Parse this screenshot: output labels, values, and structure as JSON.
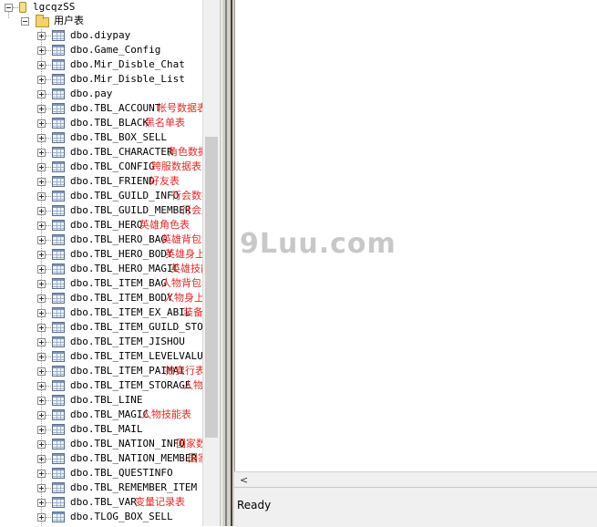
{
  "tree": {
    "database": "lgcqzSS",
    "folder": "用户表",
    "tables": [
      {
        "name": "dbo.diypay",
        "note": ""
      },
      {
        "name": "dbo.Game_Config",
        "note": ""
      },
      {
        "name": "dbo.Mir_Disble_Chat",
        "note": ""
      },
      {
        "name": "dbo.Mir_Disble_List",
        "note": ""
      },
      {
        "name": "dbo.pay",
        "note": ""
      },
      {
        "name": "dbo.TBL_ACCOUNT",
        "note": "帐号数据表"
      },
      {
        "name": "dbo.TBL_BLACK",
        "note": "黑名单表"
      },
      {
        "name": "dbo.TBL_BOX_SELL",
        "note": ""
      },
      {
        "name": "dbo.TBL_CHARACTER",
        "note": "角色数据表"
      },
      {
        "name": "dbo.TBL_CONFIG",
        "note": "跨服数据表"
      },
      {
        "name": "dbo.TBL_FRIEND",
        "note": "好友表"
      },
      {
        "name": "dbo.TBL_GUILD_INFO",
        "note": "行会数据表"
      },
      {
        "name": "dbo.TBL_GUILD_MEMBER",
        "note": "行会成员表"
      },
      {
        "name": "dbo.TBL_HERO",
        "note": "英雄角色表"
      },
      {
        "name": "dbo.TBL_HERO_BAG",
        "note": "英雄背包数据表"
      },
      {
        "name": "dbo.TBL_HERO_BODY",
        "note": "英雄身上装备表"
      },
      {
        "name": "dbo.TBL_HERO_MAGIC",
        "note": "英雄技能表"
      },
      {
        "name": "dbo.TBL_ITEM_BAG",
        "note": "人物背包表"
      },
      {
        "name": "dbo.TBL_ITEM_BODY",
        "note": "人物身上装备表"
      },
      {
        "name": "dbo.TBL_ITEM_EX_ABIL",
        "note": "装备自定义属性及改名表"
      },
      {
        "name": "dbo.TBL_ITEM_GUILD_STORA",
        "note": ""
      },
      {
        "name": "dbo.TBL_ITEM_JISHOU",
        "note": ""
      },
      {
        "name": "dbo.TBL_ITEM_LEVELVALUE",
        "note": ""
      },
      {
        "name": "dbo.TBL_ITEM_PAIMAI",
        "note": "拍卖行表"
      },
      {
        "name": "dbo.TBL_ITEM_STORAGE",
        "note": "人物仓库表"
      },
      {
        "name": "dbo.TBL_LINE",
        "note": ""
      },
      {
        "name": "dbo.TBL_MAGIC",
        "note": "人物技能表"
      },
      {
        "name": "dbo.TBL_MAIL",
        "note": ""
      },
      {
        "name": "dbo.TBL_NATION_INFO",
        "note": "国家数据表"
      },
      {
        "name": "dbo.TBL_NATION_MEMBER",
        "note": "国家成员表"
      },
      {
        "name": "dbo.TBL_QUESTINFO",
        "note": ""
      },
      {
        "name": "dbo.TBL_REMEMBER_ITEM",
        "note": ""
      },
      {
        "name": "dbo.TBL_VAR",
        "note": "变量记录表"
      },
      {
        "name": "dbo.TLOG_BOX_SELL",
        "note": ""
      }
    ]
  },
  "status": {
    "text": "Ready"
  },
  "watermark": "9Luu.com",
  "hscroll": {
    "left_arrow": "<"
  }
}
